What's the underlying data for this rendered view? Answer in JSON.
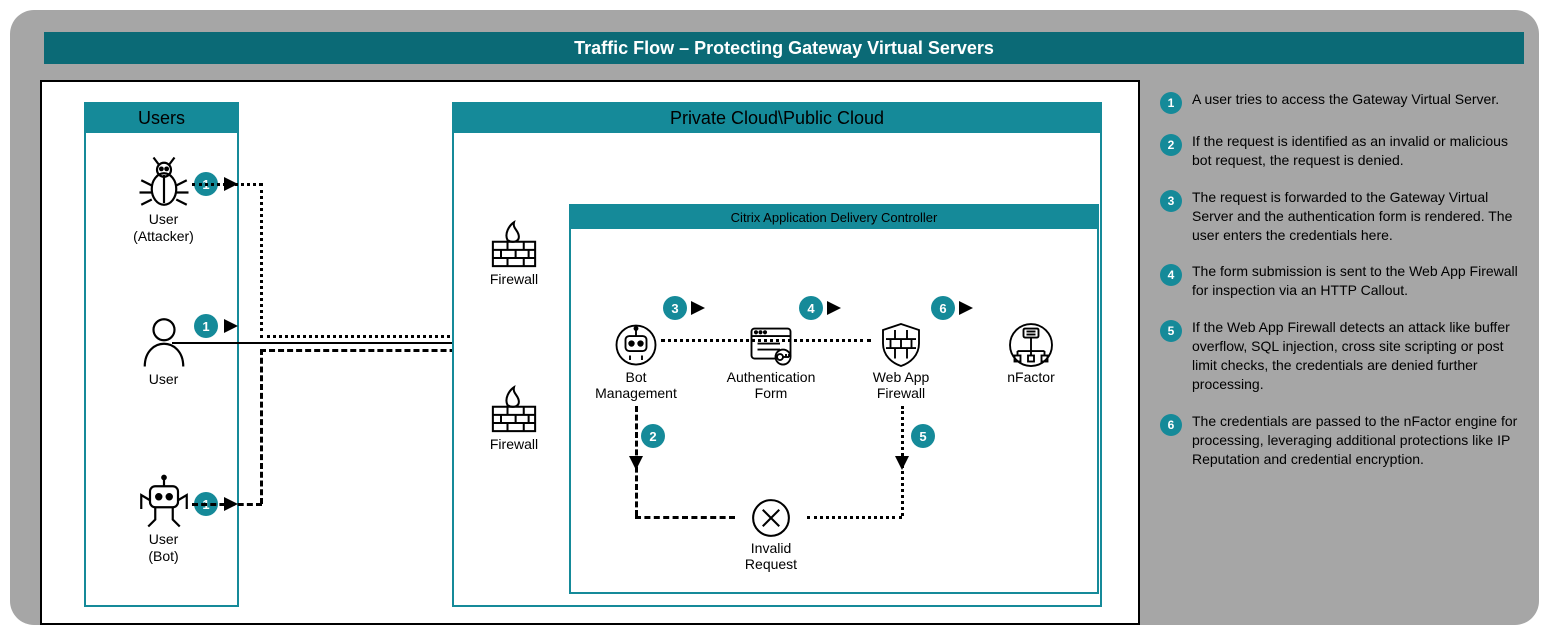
{
  "title": "Traffic Flow – Protecting Gateway Virtual Servers",
  "users": {
    "panel_title": "Users",
    "attacker": {
      "label_line1": "User",
      "label_line2": "(Attacker)"
    },
    "user": {
      "label": "User"
    },
    "bot": {
      "label_line1": "User",
      "label_line2": "(Bot)"
    }
  },
  "cloud": {
    "panel_title": "Private Cloud\\Public Cloud",
    "firewall1": "Firewall",
    "firewall2": "Firewall",
    "adc": {
      "panel_title": "Citrix Application Delivery Controller",
      "bot_mgmt": {
        "label_line1": "Bot",
        "label_line2": "Management"
      },
      "auth_form": {
        "label_line1": "Authentication",
        "label_line2": "Form"
      },
      "waf": {
        "label_line1": "Web App",
        "label_line2": "Firewall"
      },
      "nfactor": {
        "label": "nFactor"
      },
      "invalid": {
        "label_line1": "Invalid",
        "label_line2": "Request"
      }
    }
  },
  "badges": {
    "u_attacker": "1",
    "u_user": "1",
    "u_bot": "1",
    "bot_down": "2",
    "to_auth": "3",
    "to_waf": "4",
    "waf_down": "5",
    "to_nfactor": "6"
  },
  "legend": [
    {
      "num": "1",
      "text": "A user tries to access the Gateway Virtual Server."
    },
    {
      "num": "2",
      "text": "If the request is identified as an invalid or malicious bot request, the request is denied."
    },
    {
      "num": "3",
      "text": "The request is forwarded to the Gateway Virtual Server and the authentication form is rendered. The user enters the credentials here."
    },
    {
      "num": "4",
      "text": "The form submission is sent to the Web App Firewall for inspection via an HTTP Callout."
    },
    {
      "num": "5",
      "text": "If the Web App Firewall detects an attack like buffer overflow, SQL injection, cross site scripting or post limit checks, the credentials are denied further processing."
    },
    {
      "num": "6",
      "text": "The credentials are passed to the nFactor engine for processing, leveraging additional protections like IP Reputation and credential encryption."
    }
  ]
}
